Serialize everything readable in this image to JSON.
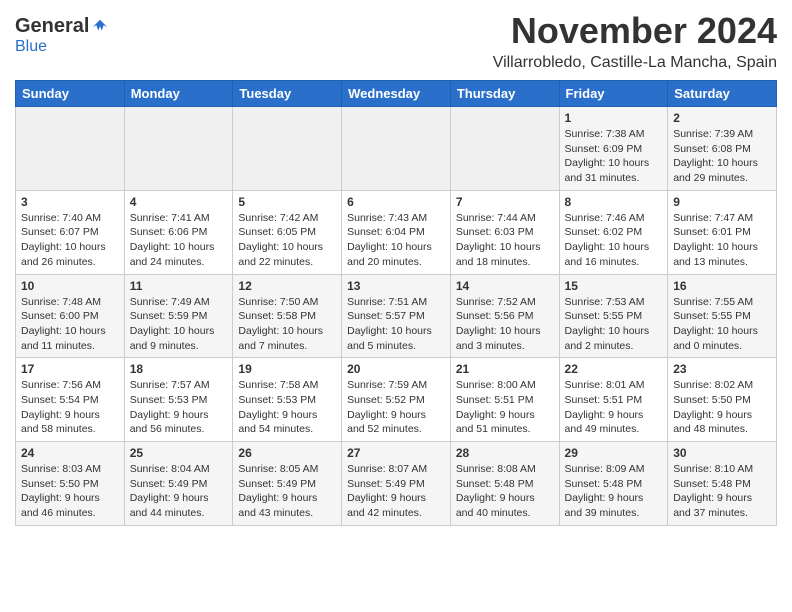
{
  "header": {
    "logo_general": "General",
    "logo_blue": "Blue",
    "month": "November 2024",
    "location": "Villarrobledo, Castille-La Mancha, Spain"
  },
  "weekdays": [
    "Sunday",
    "Monday",
    "Tuesday",
    "Wednesday",
    "Thursday",
    "Friday",
    "Saturday"
  ],
  "weeks": [
    [
      {
        "day": "",
        "info": ""
      },
      {
        "day": "",
        "info": ""
      },
      {
        "day": "",
        "info": ""
      },
      {
        "day": "",
        "info": ""
      },
      {
        "day": "",
        "info": ""
      },
      {
        "day": "1",
        "info": "Sunrise: 7:38 AM\nSunset: 6:09 PM\nDaylight: 10 hours and 31 minutes."
      },
      {
        "day": "2",
        "info": "Sunrise: 7:39 AM\nSunset: 6:08 PM\nDaylight: 10 hours and 29 minutes."
      }
    ],
    [
      {
        "day": "3",
        "info": "Sunrise: 7:40 AM\nSunset: 6:07 PM\nDaylight: 10 hours and 26 minutes."
      },
      {
        "day": "4",
        "info": "Sunrise: 7:41 AM\nSunset: 6:06 PM\nDaylight: 10 hours and 24 minutes."
      },
      {
        "day": "5",
        "info": "Sunrise: 7:42 AM\nSunset: 6:05 PM\nDaylight: 10 hours and 22 minutes."
      },
      {
        "day": "6",
        "info": "Sunrise: 7:43 AM\nSunset: 6:04 PM\nDaylight: 10 hours and 20 minutes."
      },
      {
        "day": "7",
        "info": "Sunrise: 7:44 AM\nSunset: 6:03 PM\nDaylight: 10 hours and 18 minutes."
      },
      {
        "day": "8",
        "info": "Sunrise: 7:46 AM\nSunset: 6:02 PM\nDaylight: 10 hours and 16 minutes."
      },
      {
        "day": "9",
        "info": "Sunrise: 7:47 AM\nSunset: 6:01 PM\nDaylight: 10 hours and 13 minutes."
      }
    ],
    [
      {
        "day": "10",
        "info": "Sunrise: 7:48 AM\nSunset: 6:00 PM\nDaylight: 10 hours and 11 minutes."
      },
      {
        "day": "11",
        "info": "Sunrise: 7:49 AM\nSunset: 5:59 PM\nDaylight: 10 hours and 9 minutes."
      },
      {
        "day": "12",
        "info": "Sunrise: 7:50 AM\nSunset: 5:58 PM\nDaylight: 10 hours and 7 minutes."
      },
      {
        "day": "13",
        "info": "Sunrise: 7:51 AM\nSunset: 5:57 PM\nDaylight: 10 hours and 5 minutes."
      },
      {
        "day": "14",
        "info": "Sunrise: 7:52 AM\nSunset: 5:56 PM\nDaylight: 10 hours and 3 minutes."
      },
      {
        "day": "15",
        "info": "Sunrise: 7:53 AM\nSunset: 5:55 PM\nDaylight: 10 hours and 2 minutes."
      },
      {
        "day": "16",
        "info": "Sunrise: 7:55 AM\nSunset: 5:55 PM\nDaylight: 10 hours and 0 minutes."
      }
    ],
    [
      {
        "day": "17",
        "info": "Sunrise: 7:56 AM\nSunset: 5:54 PM\nDaylight: 9 hours and 58 minutes."
      },
      {
        "day": "18",
        "info": "Sunrise: 7:57 AM\nSunset: 5:53 PM\nDaylight: 9 hours and 56 minutes."
      },
      {
        "day": "19",
        "info": "Sunrise: 7:58 AM\nSunset: 5:53 PM\nDaylight: 9 hours and 54 minutes."
      },
      {
        "day": "20",
        "info": "Sunrise: 7:59 AM\nSunset: 5:52 PM\nDaylight: 9 hours and 52 minutes."
      },
      {
        "day": "21",
        "info": "Sunrise: 8:00 AM\nSunset: 5:51 PM\nDaylight: 9 hours and 51 minutes."
      },
      {
        "day": "22",
        "info": "Sunrise: 8:01 AM\nSunset: 5:51 PM\nDaylight: 9 hours and 49 minutes."
      },
      {
        "day": "23",
        "info": "Sunrise: 8:02 AM\nSunset: 5:50 PM\nDaylight: 9 hours and 48 minutes."
      }
    ],
    [
      {
        "day": "24",
        "info": "Sunrise: 8:03 AM\nSunset: 5:50 PM\nDaylight: 9 hours and 46 minutes."
      },
      {
        "day": "25",
        "info": "Sunrise: 8:04 AM\nSunset: 5:49 PM\nDaylight: 9 hours and 44 minutes."
      },
      {
        "day": "26",
        "info": "Sunrise: 8:05 AM\nSunset: 5:49 PM\nDaylight: 9 hours and 43 minutes."
      },
      {
        "day": "27",
        "info": "Sunrise: 8:07 AM\nSunset: 5:49 PM\nDaylight: 9 hours and 42 minutes."
      },
      {
        "day": "28",
        "info": "Sunrise: 8:08 AM\nSunset: 5:48 PM\nDaylight: 9 hours and 40 minutes."
      },
      {
        "day": "29",
        "info": "Sunrise: 8:09 AM\nSunset: 5:48 PM\nDaylight: 9 hours and 39 minutes."
      },
      {
        "day": "30",
        "info": "Sunrise: 8:10 AM\nSunset: 5:48 PM\nDaylight: 9 hours and 37 minutes."
      }
    ]
  ]
}
